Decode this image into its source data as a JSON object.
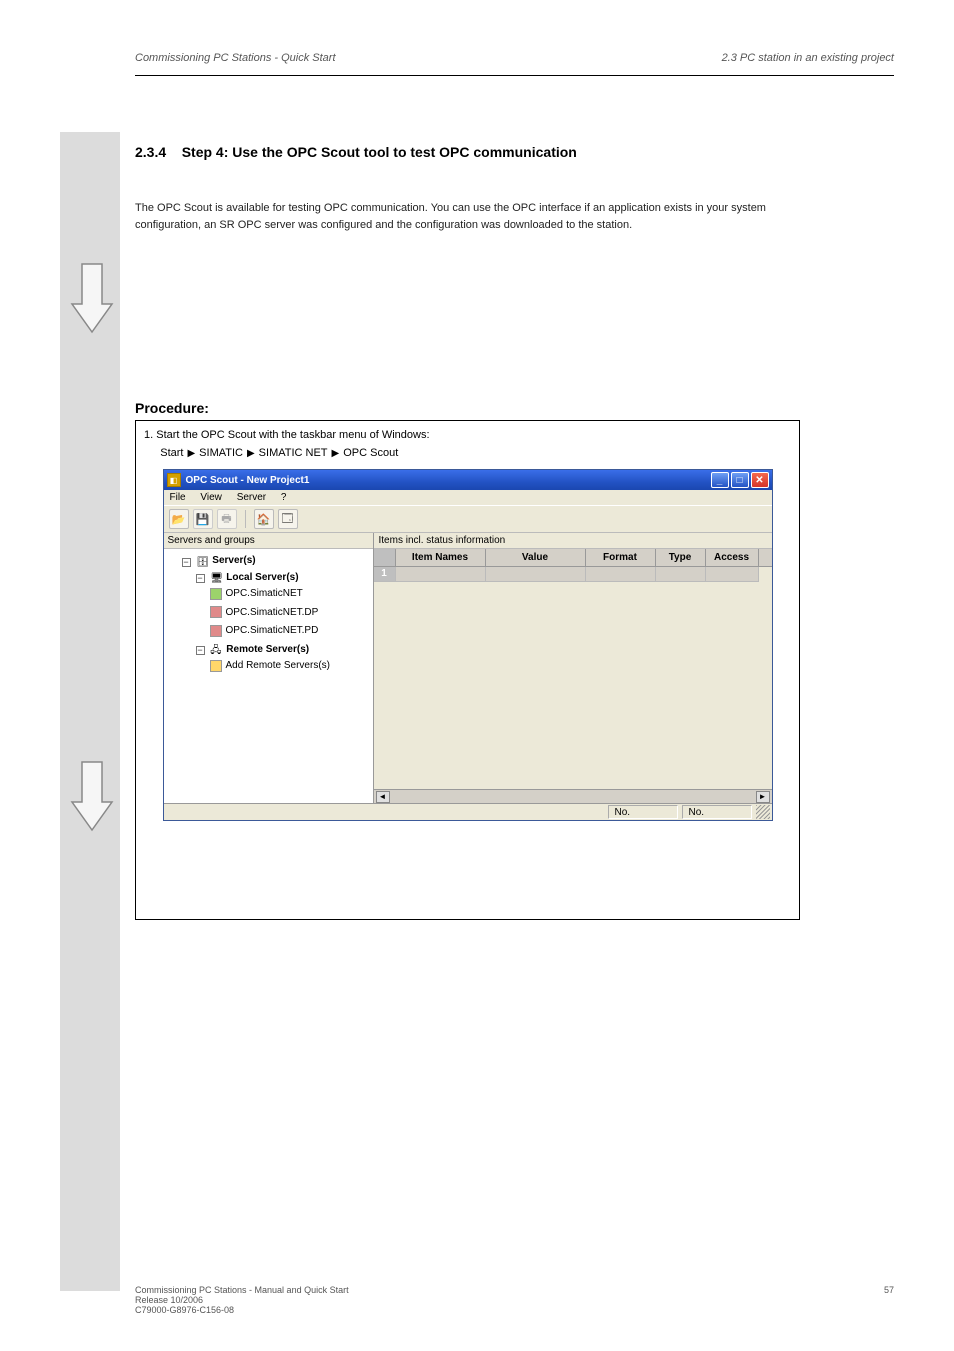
{
  "header": {
    "chapter_label": "Commissioning PC Stations - Quick Start",
    "section_ref": "2.3 PC station in an existing project"
  },
  "section": {
    "title_number": "2.3.4",
    "title_text": "Step 4: Use the OPC Scout tool to test OPC communication"
  },
  "para1": "The OPC Scout is available for testing OPC communication. You can use the OPC interface if an application exists in your system configuration, an SR OPC server was configured and the configuration was downloaded to the station.",
  "heading_procedure": "Procedure:",
  "fig": {
    "caption": "1. Start the OPC Scout with the taskbar menu of Windows:",
    "path_segments": [
      "Start",
      "SIMATIC",
      "SIMATIC NET",
      "OPC Scout"
    ]
  },
  "opc": {
    "title": "OPC Scout - New Project1",
    "menu": {
      "file": "File",
      "view": "View",
      "server": "Server",
      "help": "?"
    },
    "toolbar": {
      "open": "open-icon",
      "save": "save-icon",
      "print": "print-icon",
      "explorer": "explorer-icon",
      "home": "home-icon"
    },
    "left_header": "Servers and groups",
    "right_header": "Items incl. status information",
    "tree": {
      "root": "Server(s)",
      "local": "Local Server(s)",
      "local_items": [
        "OPC.SimaticNET",
        "OPC.SimaticNET.DP",
        "OPC.SimaticNET.PD"
      ],
      "remote": "Remote Server(s)",
      "remote_add": "Add Remote Servers(s)"
    },
    "columns": {
      "item_names": "Item Names",
      "value": "Value",
      "format": "Format",
      "type": "Type",
      "access": "Access"
    },
    "row1_num": "1",
    "status": {
      "left": "",
      "cell1": "No.",
      "cell2": "No."
    }
  },
  "footer": {
    "left": "Commissioning PC Stations - Manual and Quick Start",
    "release": "Release 10/2006",
    "doc_id": "C79000-G8976-C156-08",
    "page": "57"
  }
}
